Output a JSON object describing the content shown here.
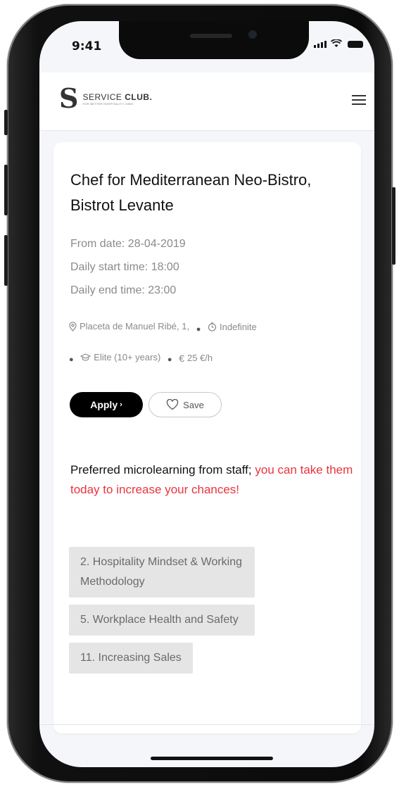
{
  "status_bar": {
    "time": "9:41"
  },
  "app_bar": {
    "logo_letter": "S",
    "logo_prefix": "SERVICE ",
    "logo_bold": "CLUB.",
    "logo_tagline": "FOR BETTER HOSPITALITY JOBS"
  },
  "job": {
    "title": "Chef for Mediterranean Neo-Bistro, Bistrot Levante",
    "from_date": "From date: 28-04-2019",
    "start_time": "Daily start time: 18:00",
    "end_time": "Daily end time: 23:00",
    "location": "Placeta de Manuel Ribé, 1,",
    "duration": "Indefinite",
    "experience": "Elite (10+ years)",
    "rate": "25 €/h",
    "icons": {
      "location": "location-pin-icon",
      "duration": "clock-icon",
      "experience": "graduation-cap-icon",
      "rate": "euro-icon"
    }
  },
  "actions": {
    "apply_label": "Apply",
    "apply_chevron": "›",
    "save_label": "Save"
  },
  "microlearning": {
    "heading": "Preferred microlearning from staff;",
    "cta": "you can take them today to increase your chances!",
    "courses": [
      "2. Hospitality Mindset & Working Methodology",
      "5. Workplace Health and Safety",
      "11. Increasing Sales"
    ]
  },
  "colors": {
    "accent_red": "#e8343f",
    "apply_bg": "#000000",
    "course_bg": "#e5e5e5"
  }
}
